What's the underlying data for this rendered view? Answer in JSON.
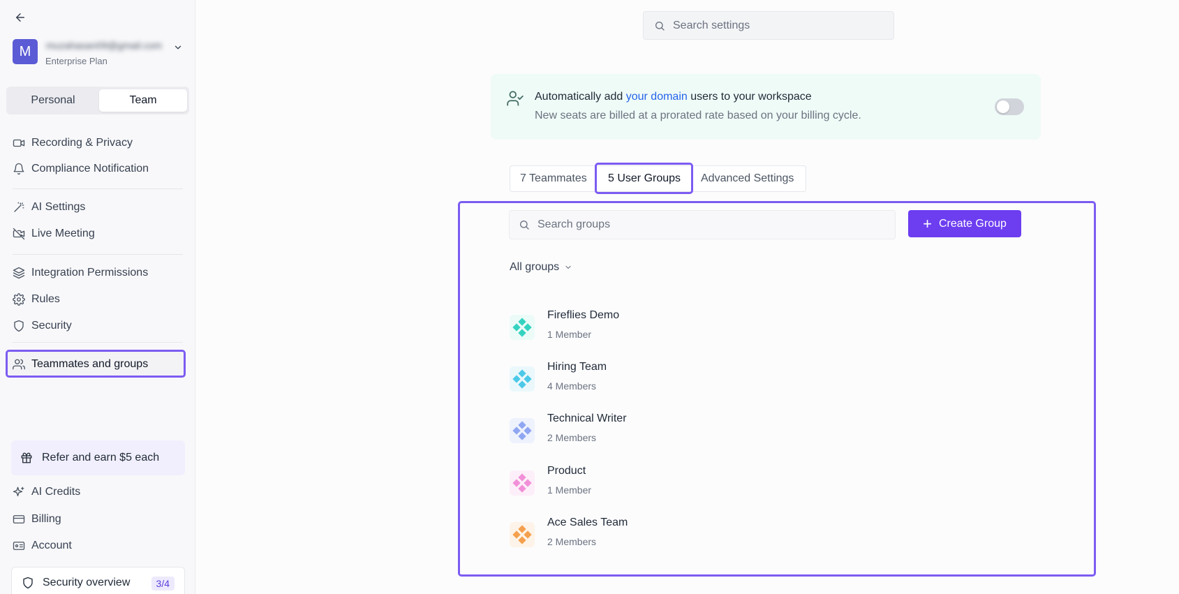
{
  "sidebar": {
    "account": {
      "avatar_letter": "M",
      "email": "muzahasan09@gmail.com",
      "plan": "Enterprise Plan"
    },
    "segments": {
      "personal": "Personal",
      "team": "Team"
    },
    "items": [
      {
        "label": "Recording & Privacy",
        "icon": "video-icon"
      },
      {
        "label": "Compliance Notification",
        "icon": "bell-icon"
      },
      {
        "label": "AI Settings",
        "icon": "magic-wand-icon"
      },
      {
        "label": "Live Meeting",
        "icon": "video-off-icon"
      },
      {
        "label": "Integration Permissions",
        "icon": "layers-icon"
      },
      {
        "label": "Rules",
        "icon": "gear-icon"
      },
      {
        "label": "Security",
        "icon": "shield-icon"
      },
      {
        "label": "Teammates and groups",
        "icon": "users-icon"
      }
    ],
    "refer": "Refer and earn $5 each",
    "bottom_items": [
      {
        "label": "AI Credits",
        "icon": "sparkle-icon"
      },
      {
        "label": "Billing",
        "icon": "credit-card-icon"
      },
      {
        "label": "Account",
        "icon": "id-card-icon"
      }
    ],
    "security_overview": {
      "label": "Security overview",
      "badge": "3/4"
    }
  },
  "main": {
    "search_placeholder": "Search settings",
    "banner": {
      "title_pre": "Automatically add ",
      "title_link": "your domain",
      "title_post": " users to your workspace",
      "subtitle": "New seats are billed at a prorated rate based on your billing cycle.",
      "toggle_on": false
    },
    "tabs": [
      "7 Teammates",
      "5 User Groups",
      "Advanced Settings"
    ],
    "groups_search_placeholder": "Search groups",
    "create_button": "Create Group",
    "filter_label": "All groups",
    "groups": [
      {
        "name": "Fireflies Demo",
        "members": "1 Member",
        "color": "#34d3c0",
        "bg": "#ecfbf8"
      },
      {
        "name": "Hiring Team",
        "members": "4 Members",
        "color": "#4cc9e8",
        "bg": "#eaf8fc"
      },
      {
        "name": "Technical Writer",
        "members": "2 Members",
        "color": "#8fa6f2",
        "bg": "#eef2fd"
      },
      {
        "name": "Product",
        "members": "1 Member",
        "color": "#f190d8",
        "bg": "#fdeff9"
      },
      {
        "name": "Ace Sales Team",
        "members": "2 Members",
        "color": "#f5a04e",
        "bg": "#fef3e8"
      }
    ]
  }
}
